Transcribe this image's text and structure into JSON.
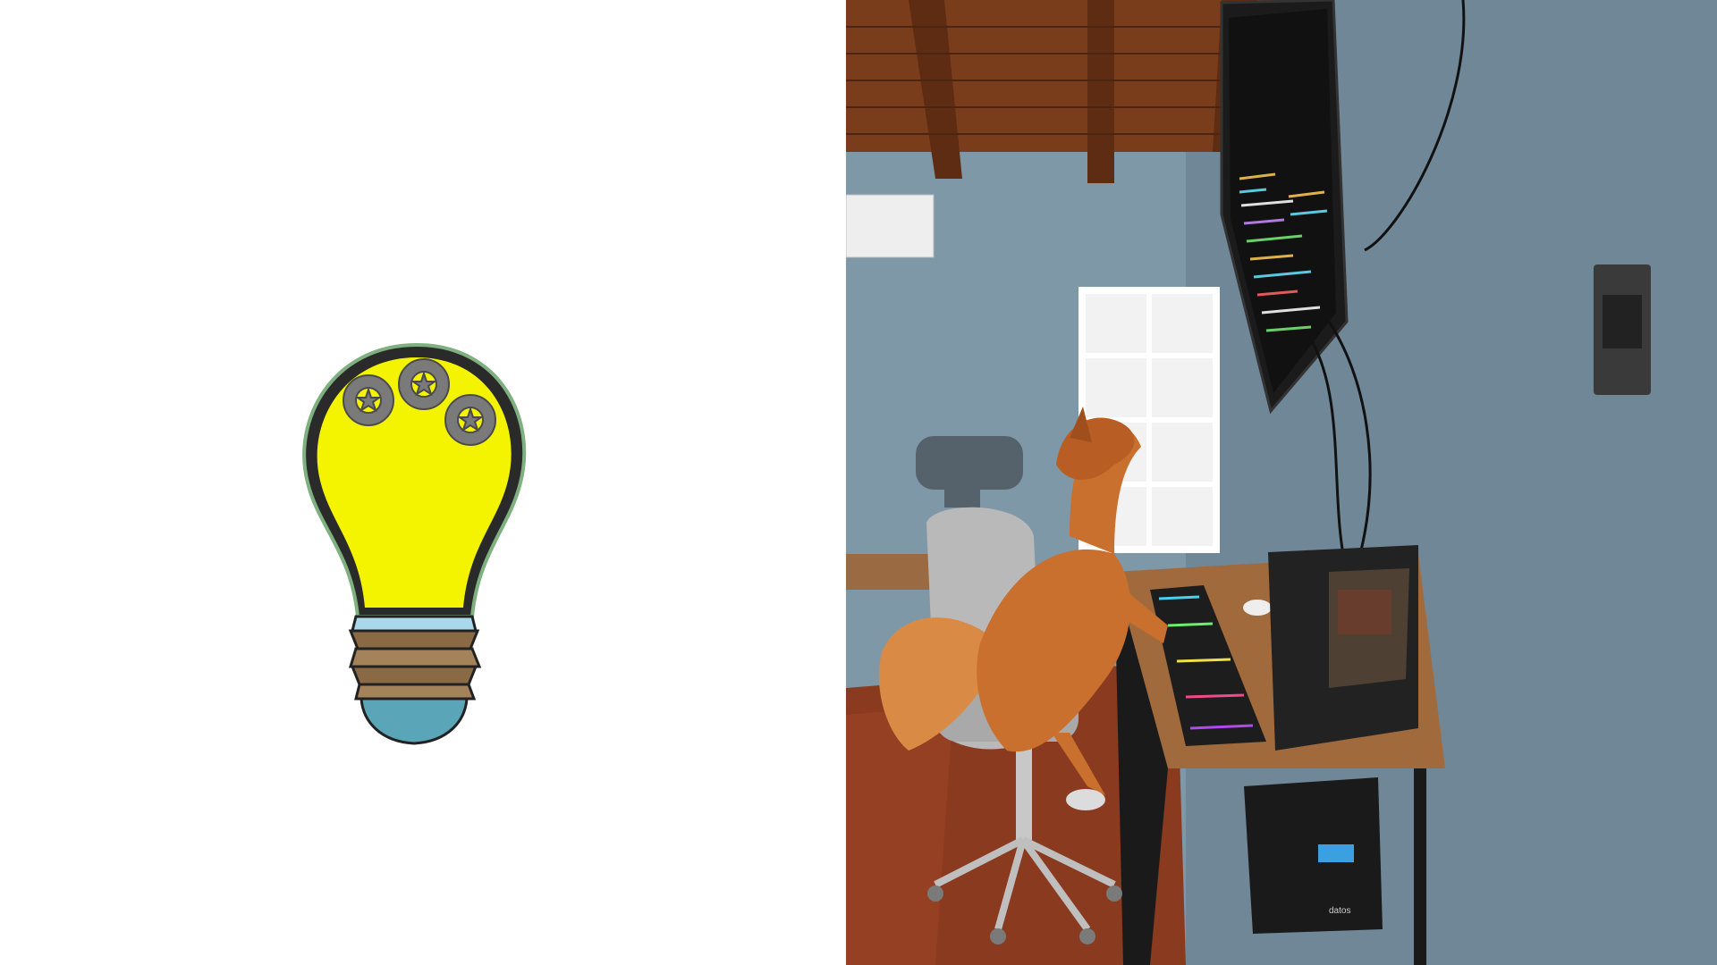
{
  "left_panel": {
    "illustration": "lightbulb-with-gears-icon",
    "colors": {
      "bulb_fill": "#f4f400",
      "bulb_outline": "#111111",
      "gear_fill": "#7a7a7a",
      "base_band_light": "#a9d8ea",
      "base_brown": "#8a6a45",
      "base_tip": "#5aa6b8"
    }
  },
  "right_panel": {
    "scene": "fox-at-computer-desk-photo",
    "ups_label": "datos",
    "colors": {
      "wall": "#7f98a8",
      "ceiling_wood": "#7a3d1c",
      "floor": "#8a3a1f",
      "desk": "#a06a3c",
      "fox": "#c9702e",
      "monitor": "#1b1b1b",
      "pc_case": "#222222"
    }
  }
}
